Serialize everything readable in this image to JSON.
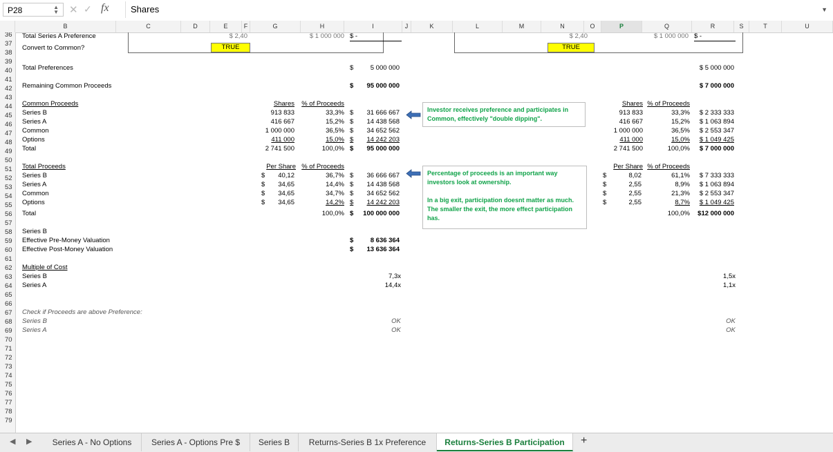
{
  "formula_bar": {
    "cell_ref": "P28",
    "cancel_icon": "✕",
    "confirm_icon": "✓",
    "fx_label": "fx",
    "value": "Shares"
  },
  "columns": [
    "B",
    "C",
    "D",
    "E",
    "F",
    "G",
    "H",
    "I",
    "J",
    "K",
    "L",
    "M",
    "N",
    "O",
    "P",
    "Q",
    "R",
    "S",
    "T",
    "U"
  ],
  "selected_column": "P",
  "rows": [
    "36",
    "37",
    "38",
    "39",
    "40",
    "41",
    "42",
    "43",
    "44",
    "45",
    "46",
    "47",
    "48",
    "49",
    "50",
    "51",
    "52",
    "53",
    "54",
    "55",
    "56",
    "57",
    "58",
    "59",
    "60",
    "61",
    "62",
    "63",
    "64",
    "65",
    "66",
    "67",
    "68",
    "69",
    "70",
    "71",
    "72",
    "73",
    "74",
    "75",
    "76",
    "77",
    "78",
    "79"
  ],
  "cells": {
    "r36_label": "Total Series A Preference",
    "r36_e": "$ 2,40",
    "r36_h": "$ 1 000 000",
    "r36_i": "$ -",
    "r36_n": "$ 2,40",
    "r36_q": "$ 1 000 000",
    "r36_r": "$ -",
    "r37_label": "Convert to Common?",
    "r37_flag_left": "TRUE",
    "r37_flag_right": "TRUE",
    "r39_label": "Total Preferences",
    "r39_dollar": "$",
    "r39_val": "5 000 000",
    "r39_right": "$ 5 000 000",
    "r41_label": "Remaining Common Proceeds",
    "r41_dollar": "$",
    "r41_val": "95 000 000",
    "r41_right": "$ 7 000 000",
    "r43_label": "Common Proceeds",
    "r43_shares": "Shares",
    "r43_pct": "% of Proceeds",
    "r43_shares_r": "Shares",
    "r43_pct_r": "% of Proceeds",
    "common": [
      {
        "label": "Series B",
        "shares": "913 833",
        "pct": "33,3%",
        "dollar": "$",
        "val": "31 666 667",
        "shares_r": "913 833",
        "pct_r": "33,3%",
        "val_r": "$ 2 333 333"
      },
      {
        "label": "Series A",
        "shares": "416 667",
        "pct": "15,2%",
        "dollar": "$",
        "val": "14 438 568",
        "shares_r": "416 667",
        "pct_r": "15,2%",
        "val_r": "$ 1 063 894"
      },
      {
        "label": "Common",
        "shares": "1 000 000",
        "pct": "36,5%",
        "dollar": "$",
        "val": "34 652 562",
        "shares_r": "1 000 000",
        "pct_r": "36,5%",
        "val_r": "$ 2 553 347"
      },
      {
        "label": "Options",
        "shares": "411 000",
        "pct": "15,0%",
        "dollar": "$",
        "val": "14 242 203",
        "shares_r": "411 000",
        "pct_r": "15,0%",
        "val_r": "$ 1 049 425"
      },
      {
        "label": "Total",
        "shares": "2 741 500",
        "pct": "100,0%",
        "dollar": "$",
        "val": "95 000 000",
        "shares_r": "2 741 500",
        "pct_r": "100,0%",
        "val_r": "$ 7 000 000"
      }
    ],
    "r50_label": "Total Proceeds",
    "r50_pershare": "Per Share",
    "r50_pct": "% of Proceeds",
    "r50_pershare_r": "Per Share",
    "r50_pct_r": "% of Proceeds",
    "total": [
      {
        "label": "Series B",
        "ps_dollar": "$",
        "ps": "40,12",
        "pct": "36,7%",
        "dollar": "$",
        "val": "36 666 667",
        "ps_dollar_r": "$",
        "ps_r": "8,02",
        "pct_r": "61,1%",
        "val_r": "$ 7 333 333"
      },
      {
        "label": "Series A",
        "ps_dollar": "$",
        "ps": "34,65",
        "pct": "14,4%",
        "dollar": "$",
        "val": "14 438 568",
        "ps_dollar_r": "$",
        "ps_r": "2,55",
        "pct_r": "8,9%",
        "val_r": "$ 1 063 894"
      },
      {
        "label": "Common",
        "ps_dollar": "$",
        "ps": "34,65",
        "pct": "34,7%",
        "dollar": "$",
        "val": "34 652 562",
        "ps_dollar_r": "$",
        "ps_r": "2,55",
        "pct_r": "21,3%",
        "val_r": "$ 2 553 347"
      },
      {
        "label": "Options",
        "ps_dollar": "$",
        "ps": "34,65",
        "pct": "14,2%",
        "dollar": "$",
        "val": "14 242 203",
        "ps_dollar_r": "$",
        "ps_r": "2,55",
        "pct_r": "8,7%",
        "val_r": "$ 1 049 425"
      }
    ],
    "r55_label": "Total",
    "r55_pct": "100,0%",
    "r55_dollar": "$",
    "r55_val": "100 000 000",
    "r55_pct_r": "100,0%",
    "r55_val_r": "$12 000 000",
    "r57_label": "Series B",
    "r58_label": "Effective Pre-Money Valuation",
    "r58_dollar": "$",
    "r58_val": "8 636 364",
    "r59_label": "Effective Post-Money Valuation",
    "r59_dollar": "$",
    "r59_val": "13 636 364",
    "r61_label": "Multiple of Cost",
    "r62_label": "Series B",
    "r62_val": "7,3x",
    "r62_right": "1,5x",
    "r63_label": "Series A",
    "r63_val": "14,4x",
    "r63_right": "1,1x",
    "r66_label": "Check if Proceeds are above Preference:",
    "r67_label": "Series B",
    "r67_val": "OK",
    "r67_right": "OK",
    "r68_label": "Series A",
    "r68_val": "OK",
    "r68_right": "OK"
  },
  "notes": {
    "note1": "Investor receives preference and participates in Common, effectively \"double dipping\".",
    "note2a": "Percentage of proceeds is an important way investors look at ownership.",
    "note2b": "In a big exit, participation doesnt matter as much. The smaller the exit, the more effect participation has."
  },
  "tabs": [
    {
      "label": "Series A - No Options",
      "active": false
    },
    {
      "label": "Series A - Options Pre $",
      "active": false
    },
    {
      "label": "Series B",
      "active": false
    },
    {
      "label": "Returns-Series B 1x Preference",
      "active": false
    },
    {
      "label": "Returns-Series B Participation",
      "active": true
    }
  ],
  "tab_nav": {
    "prev": "◀",
    "next": "▶",
    "add": "+"
  },
  "colors": {
    "accent_green": "#1a7f3c",
    "note_green": "#11a34a",
    "highlight_yellow": "#ffff00",
    "arrow_blue": "#3d6fb6"
  }
}
